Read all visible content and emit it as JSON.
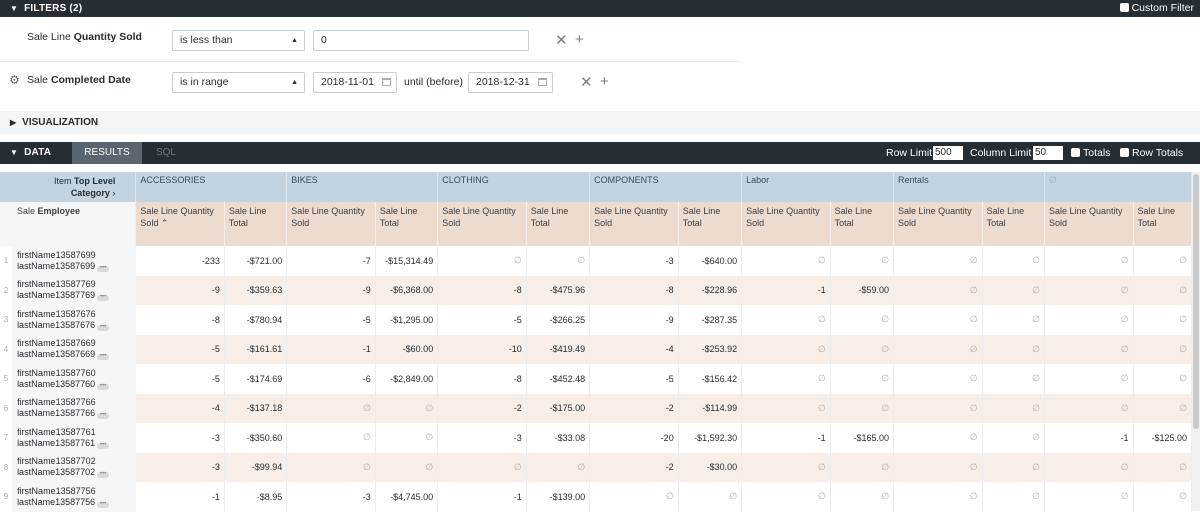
{
  "filters": {
    "title": "FILTERS (2)",
    "custom_filter": "Custom Filter",
    "rows": [
      {
        "label_prefix": "Sale Line ",
        "label_bold": "Quantity Sold",
        "operator": "is less than",
        "value": "0"
      },
      {
        "label_prefix": "Sale ",
        "label_bold": "Completed Date",
        "operator": "is in range",
        "from": "2018-11-01",
        "until_label": "until (before)",
        "to": "2018-12-31"
      }
    ]
  },
  "visualization": {
    "title": "VISUALIZATION"
  },
  "data_bar": {
    "title": "DATA",
    "tabs": [
      "RESULTS",
      "SQL"
    ],
    "row_limit_label": "Row Limit",
    "row_limit": "500",
    "column_limit_label": "Column Limit",
    "column_limit": "50",
    "totals_label": "Totals",
    "row_totals_label": "Row Totals"
  },
  "table": {
    "pivot_label_line1_prefix": "Item ",
    "pivot_label_line1_bold": "Top Level",
    "pivot_label_line2": "Category",
    "emp_header_prefix": "Sale ",
    "emp_header_bold": "Employee",
    "categories": [
      "ACCESSORIES",
      "BIKES",
      "CLOTHING",
      "COMPONENTS",
      "Labor",
      "Rentals",
      "∅"
    ],
    "measure_qty": "Sale Line Quantity Sold",
    "measure_total": "Sale Line Total",
    "rows": [
      {
        "i": "1",
        "first": "firstName13587699",
        "last": "lastName13587699",
        "v": [
          "-233",
          "-$721.00",
          "-7",
          "-$15,314.49",
          "∅",
          "∅",
          "-3",
          "-$640.00",
          "∅",
          "∅",
          "∅",
          "∅",
          "∅",
          "∅"
        ]
      },
      {
        "i": "2",
        "first": "firstName13587769",
        "last": "lastName13587769",
        "v": [
          "-9",
          "-$359.63",
          "-9",
          "-$6,368.00",
          "-8",
          "-$475.96",
          "-8",
          "-$228.96",
          "-1",
          "-$59.00",
          "∅",
          "∅",
          "∅",
          "∅"
        ]
      },
      {
        "i": "3",
        "first": "firstName13587676",
        "last": "lastName13587676",
        "v": [
          "-8",
          "-$780.94",
          "-5",
          "-$1,295.00",
          "-5",
          "-$266.25",
          "-9",
          "-$287.35",
          "∅",
          "∅",
          "∅",
          "∅",
          "∅",
          "∅"
        ]
      },
      {
        "i": "4",
        "first": "firstName13587669",
        "last": "lastName13587669",
        "v": [
          "-5",
          "-$161.61",
          "-1",
          "-$60.00",
          "-10",
          "-$419.49",
          "-4",
          "-$253.92",
          "∅",
          "∅",
          "∅",
          "∅",
          "∅",
          "∅"
        ]
      },
      {
        "i": "5",
        "first": "firstName13587760",
        "last": "lastName13587760",
        "v": [
          "-5",
          "-$174.69",
          "-6",
          "-$2,849.00",
          "-8",
          "-$452.48",
          "-5",
          "-$156.42",
          "∅",
          "∅",
          "∅",
          "∅",
          "∅",
          "∅"
        ]
      },
      {
        "i": "6",
        "first": "firstName13587766",
        "last": "lastName13587766",
        "v": [
          "-4",
          "-$137.18",
          "∅",
          "∅",
          "-2",
          "-$175.00",
          "-2",
          "-$114.99",
          "∅",
          "∅",
          "∅",
          "∅",
          "∅",
          "∅"
        ]
      },
      {
        "i": "7",
        "first": "firstName13587761",
        "last": "lastName13587761",
        "v": [
          "-3",
          "-$350.60",
          "∅",
          "∅",
          "-3",
          "-$33.08",
          "-20",
          "-$1,592.30",
          "-1",
          "-$165.00",
          "∅",
          "∅",
          "-1",
          "-$125.00"
        ]
      },
      {
        "i": "8",
        "first": "firstName13587702",
        "last": "lastName13587702",
        "v": [
          "-3",
          "-$99.94",
          "∅",
          "∅",
          "∅",
          "∅",
          "-2",
          "-$30.00",
          "∅",
          "∅",
          "∅",
          "∅",
          "∅",
          "∅"
        ]
      },
      {
        "i": "9",
        "first": "firstName13587756",
        "last": "lastName13587756",
        "v": [
          "-1",
          "-$8.95",
          "-3",
          "-$4,745.00",
          "-1",
          "-$139.00",
          "∅",
          "∅",
          "∅",
          "∅",
          "∅",
          "∅",
          "∅",
          "∅"
        ]
      }
    ]
  }
}
